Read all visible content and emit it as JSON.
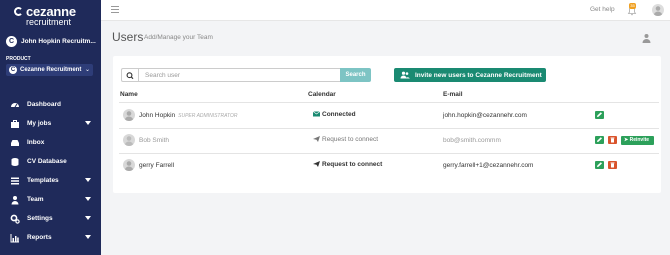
{
  "brand": {
    "name": "cezanne",
    "sub": "recruitment"
  },
  "sidebar": {
    "company": "John Hopkin Recruitm...",
    "product_label": "PRODUCT",
    "product_value": "Cezanne Recruitment",
    "items": [
      {
        "label": "Dashboard",
        "icon": "dashboard-icon",
        "has_children": false
      },
      {
        "label": "My jobs",
        "icon": "briefcase-icon",
        "has_children": true
      },
      {
        "label": "Inbox",
        "icon": "inbox-icon",
        "has_children": false
      },
      {
        "label": "CV Database",
        "icon": "database-icon",
        "has_children": false
      },
      {
        "label": "Templates",
        "icon": "templates-icon",
        "has_children": true
      },
      {
        "label": "Team",
        "icon": "team-icon",
        "has_children": true
      },
      {
        "label": "Settings",
        "icon": "settings-icon",
        "has_children": true
      },
      {
        "label": "Reports",
        "icon": "reports-icon",
        "has_children": true
      }
    ]
  },
  "topbar": {
    "get_help": "Get help",
    "notification_count": "35"
  },
  "page": {
    "title": "Users",
    "subtitle": "Add/Manage your Team"
  },
  "search": {
    "placeholder": "Search user",
    "button": "Search"
  },
  "invite_button": "Invite new users to Cezanne Recruitment",
  "table": {
    "columns": [
      "Name",
      "Calendar",
      "E-mail"
    ],
    "rows": [
      {
        "name": "John Hopkin",
        "role": "SUPER ADMINISTRATOR",
        "calendar": "Connected",
        "email": "john.hopkin@cezannehr.com",
        "muted": false,
        "actions": [
          "edit"
        ]
      },
      {
        "name": "Bob Smith",
        "role": "",
        "calendar": "Request to connect",
        "email": "bob@smith.commm",
        "muted": true,
        "actions": [
          "edit",
          "delete",
          "reinvite"
        ],
        "reinvite_label": "Reinvite"
      },
      {
        "name": "gerry Farrell",
        "role": "",
        "calendar": "Request to connect",
        "email": "gerry.farrell+1@cezannehr.com",
        "muted": false,
        "actions": [
          "edit",
          "delete"
        ]
      }
    ]
  },
  "colors": {
    "sidebar": "#1f2a5a",
    "primary": "#1a8a72",
    "edit": "#2ca05a",
    "delete": "#d9542c",
    "search": "#7dc4c4"
  }
}
